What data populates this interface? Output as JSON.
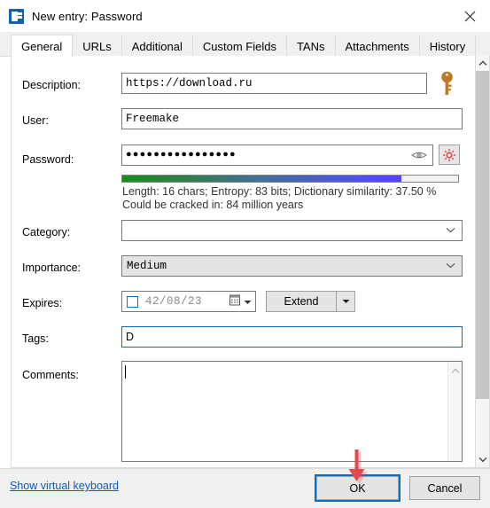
{
  "window": {
    "title": "New entry: Password",
    "icon": "keepass-icon",
    "close_label": "close-icon"
  },
  "tabs": [
    {
      "label": "General",
      "active": true
    },
    {
      "label": "URLs",
      "active": false
    },
    {
      "label": "Additional",
      "active": false
    },
    {
      "label": "Custom Fields",
      "active": false
    },
    {
      "label": "TANs",
      "active": false
    },
    {
      "label": "Attachments",
      "active": false
    },
    {
      "label": "History",
      "active": false
    }
  ],
  "form": {
    "description": {
      "label": "Description:",
      "value": "https://download.ru"
    },
    "user": {
      "label": "User:",
      "value": "Freemake"
    },
    "password": {
      "label": "Password:",
      "value": "●●●●●●●●●●●●●●●●",
      "reveal_icon": "eye-icon",
      "generate_icon": "gear-icon"
    },
    "quality": {
      "percent": 83,
      "line1": "Length: 16 chars; Entropy: 83 bits; Dictionary similarity: 37.50 %",
      "line2": "Could be cracked in:  84 million years"
    },
    "category": {
      "label": "Category:",
      "value": ""
    },
    "importance": {
      "label": "Importance:",
      "value": "Medium"
    },
    "expires": {
      "label": "Expires:",
      "checked": false,
      "date": "42/08/23",
      "extend_label": "Extend"
    },
    "tags": {
      "label": "Tags:",
      "value": "D",
      "focused": true
    },
    "comments": {
      "label": "Comments:",
      "value": ""
    }
  },
  "footer": {
    "virtual_keyboard_link": "Show virtual keyboard",
    "ok_label": "OK",
    "cancel_label": "Cancel"
  },
  "colors": {
    "accent": "#0a6fc2",
    "link": "#0b5cbf",
    "quality_start": "#159019",
    "quality_end": "#5544f5",
    "annotation": "#e8474c",
    "key_icon": "#c07820",
    "gear_icon": "#e03a3a"
  }
}
